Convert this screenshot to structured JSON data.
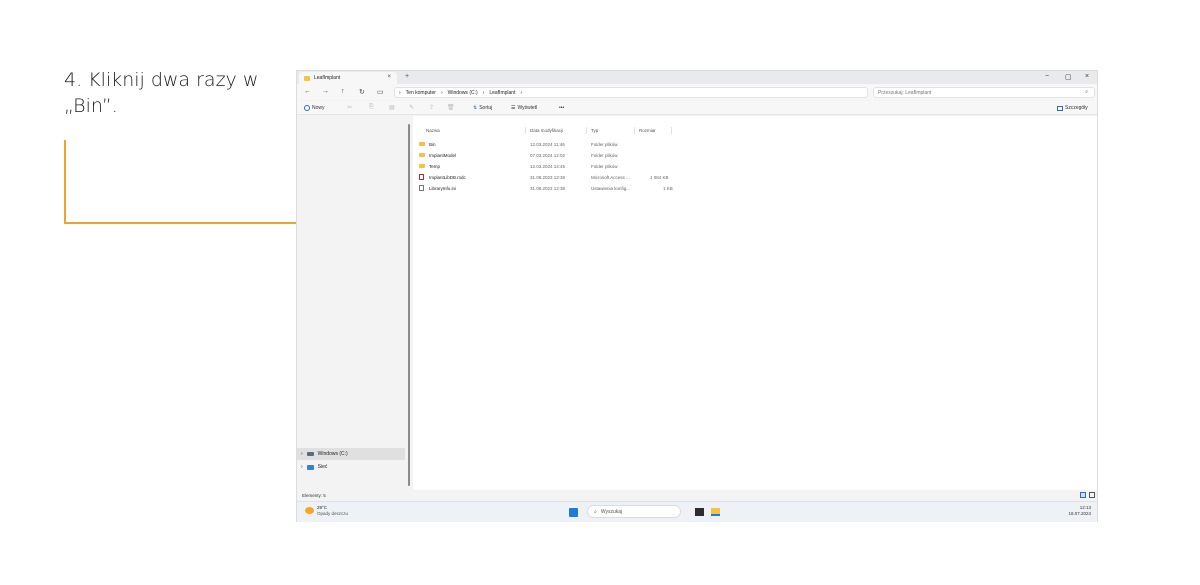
{
  "instruction": {
    "line1": "4. Kliknij dwa razy w",
    "line2": "„Bin”."
  },
  "colors": {
    "accent": "#f0a231",
    "folder": "#f5c242",
    "start_blue": "#1f7bd8"
  },
  "window": {
    "tab_title": "LeafImplant",
    "tab_close": "×",
    "new_tab": "+",
    "minimize": "−",
    "maximize": "▢",
    "close": "×"
  },
  "nav": {
    "back": "←",
    "forward": "→",
    "up": "↑",
    "refresh": "↻",
    "pc_icon": "▭",
    "breadcrumb": [
      "Ten komputer",
      "Windows (C:)",
      "LeafImplant"
    ],
    "breadcrumb_sep": "›",
    "search_placeholder": "Przeszukaj: LeafImplant",
    "search_icon": "⌕"
  },
  "toolbar": {
    "new_label": "Nowy",
    "sort_label": "Sortuj",
    "view_label": "Wyświetl",
    "more_label": "•••",
    "details_label": "Szczegóły",
    "icons": [
      "cut-icon",
      "copy-icon",
      "paste-icon",
      "rename-icon",
      "share-icon",
      "delete-icon"
    ]
  },
  "sidebar": {
    "items": [
      {
        "label": "Windows (C:)",
        "icon": "drive-icon"
      },
      {
        "label": "Sieć",
        "icon": "network-icon"
      }
    ],
    "chevron": "›"
  },
  "columns": [
    "Nazwa",
    "Data modyfikacji",
    "Typ",
    "Rozmiar"
  ],
  "files": [
    {
      "name": "Bin",
      "date": "12.03.2024 11:46",
      "type": "Folder plików",
      "size": "",
      "icon": "folder-icon"
    },
    {
      "name": "ImplantModel",
      "date": "07.03.2024 12:02",
      "type": "Folder plików",
      "size": "",
      "icon": "folder-icon"
    },
    {
      "name": "Temp",
      "date": "12.03.2024 14:45",
      "type": "Folder plików",
      "size": "",
      "icon": "folder-icon"
    },
    {
      "name": "ImplantLibDB.mdc",
      "date": "31.08.2023 12:36",
      "type": "Microsoft Access ...",
      "size": "1 084 KB",
      "icon": "database-icon"
    },
    {
      "name": "LibraryInfo.ini",
      "date": "31.08.2023 12:38",
      "type": "Ustawienia konfig...",
      "size": "1 KB",
      "icon": "document-icon"
    }
  ],
  "status": {
    "items_count": "Elementy: 5"
  },
  "taskbar": {
    "temp": "29°C",
    "weather": "Opady deszczu",
    "search_label": "Wyszukaj",
    "search_icon": "⌕",
    "time": "12:13",
    "date": "18.07.2024"
  }
}
